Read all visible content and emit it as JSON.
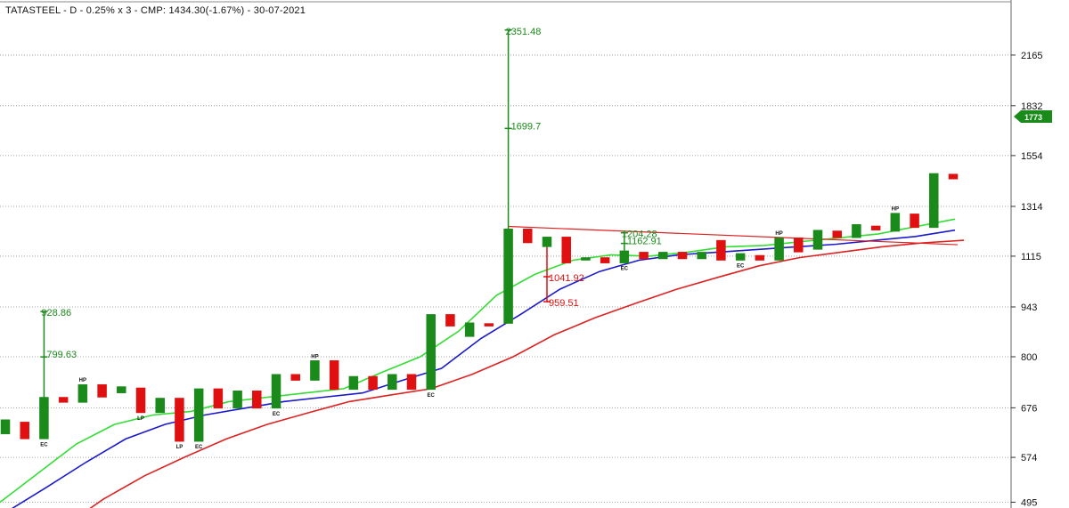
{
  "title": "TATASTEEL - D - 0.25% x 3 - CMP: 1434.30(-1.67%) - 30-07-2021",
  "colors": {
    "up": "#1a8a1a",
    "down": "#e01010",
    "ema_fast": "#33dd33",
    "ema_mid": "#1a1acc",
    "ema_slow": "#dd2222",
    "trendline": "#dd2222",
    "current_price_tag": "#1a8a1a"
  },
  "chart_data": {
    "type": "line",
    "title": "TATASTEEL - D - 0.25% x 3 - CMP: 1434.30(-1.67%) - 30-07-2021",
    "y_axis": {
      "scale": "log",
      "range": [
        480,
        2500
      ],
      "ticks": [
        574,
        676,
        800,
        943,
        1115,
        1314,
        1554,
        1832,
        2165,
        495
      ]
    },
    "grid": true,
    "current_price_tag": "1773",
    "bricks": [
      {
        "dir": "up",
        "low": 620,
        "high": 650
      },
      {
        "dir": "down",
        "low": 610,
        "high": 645
      },
      {
        "dir": "up",
        "low": 610,
        "high": 700,
        "label": "EC"
      },
      {
        "dir": "down",
        "low": 688,
        "high": 700
      },
      {
        "dir": "up",
        "low": 688,
        "high": 730,
        "label": "HP"
      },
      {
        "dir": "down",
        "low": 700,
        "high": 730
      },
      {
        "dir": "up",
        "low": 710,
        "high": 725
      },
      {
        "dir": "down",
        "low": 665,
        "high": 722,
        "label": "LP"
      },
      {
        "dir": "up",
        "low": 665,
        "high": 698
      },
      {
        "dir": "down",
        "low": 605,
        "high": 698,
        "label": "LP"
      },
      {
        "dir": "up",
        "low": 605,
        "high": 720,
        "label": "EC"
      },
      {
        "dir": "down",
        "low": 675,
        "high": 720
      },
      {
        "dir": "up",
        "low": 675,
        "high": 715
      },
      {
        "dir": "down",
        "low": 675,
        "high": 715
      },
      {
        "dir": "up",
        "low": 675,
        "high": 755,
        "label": "EC"
      },
      {
        "dir": "down",
        "low": 740,
        "high": 755
      },
      {
        "dir": "up",
        "low": 740,
        "high": 790,
        "label": "HP"
      },
      {
        "dir": "down",
        "low": 718,
        "high": 790
      },
      {
        "dir": "up",
        "low": 718,
        "high": 750
      },
      {
        "dir": "down",
        "low": 718,
        "high": 750
      },
      {
        "dir": "up",
        "low": 718,
        "high": 755
      },
      {
        "dir": "down",
        "low": 718,
        "high": 755
      },
      {
        "dir": "up",
        "low": 718,
        "high": 920,
        "label": "EC"
      },
      {
        "dir": "down",
        "low": 885,
        "high": 920
      },
      {
        "dir": "up",
        "low": 855,
        "high": 895
      },
      {
        "dir": "down",
        "low": 885,
        "high": 893
      },
      {
        "dir": "up",
        "low": 893,
        "high": 1220
      },
      {
        "dir": "down",
        "low": 1165,
        "high": 1220
      },
      {
        "dir": "up",
        "low": 1150,
        "high": 1188
      },
      {
        "dir": "down",
        "low": 1090,
        "high": 1188
      },
      {
        "dir": "up",
        "low": 1100,
        "high": 1110
      },
      {
        "dir": "down",
        "low": 1090,
        "high": 1110
      },
      {
        "dir": "up",
        "low": 1090,
        "high": 1135,
        "label": "EC"
      },
      {
        "dir": "down",
        "low": 1105,
        "high": 1130
      },
      {
        "dir": "up",
        "low": 1105,
        "high": 1130
      },
      {
        "dir": "down",
        "low": 1105,
        "high": 1130
      },
      {
        "dir": "up",
        "low": 1105,
        "high": 1130
      },
      {
        "dir": "down",
        "low": 1100,
        "high": 1175
      },
      {
        "dir": "up",
        "low": 1100,
        "high": 1125,
        "label": "EC"
      },
      {
        "dir": "down",
        "low": 1100,
        "high": 1118
      },
      {
        "dir": "up",
        "low": 1100,
        "high": 1185,
        "label": "HP"
      },
      {
        "dir": "down",
        "low": 1130,
        "high": 1185
      },
      {
        "dir": "up",
        "low": 1140,
        "high": 1215
      },
      {
        "dir": "down",
        "low": 1185,
        "high": 1212
      },
      {
        "dir": "up",
        "low": 1185,
        "high": 1238
      },
      {
        "dir": "down",
        "low": 1215,
        "high": 1232
      },
      {
        "dir": "up",
        "low": 1210,
        "high": 1285,
        "label": "HP"
      },
      {
        "dir": "down",
        "low": 1225,
        "high": 1282
      },
      {
        "dir": "up",
        "low": 1225,
        "high": 1465
      },
      {
        "dir": "down",
        "low": 1438,
        "high": 1462
      }
    ],
    "wicks": [
      {
        "brick": 2,
        "high": 928.86,
        "labels": [
          "928.86",
          "799.63"
        ],
        "mid": 799.63
      },
      {
        "brick": 26,
        "high": 2351.48,
        "labels": [
          "2351.48",
          "1699.7"
        ],
        "mid": 1699.7
      },
      {
        "brick": 28,
        "low": 959.51,
        "labels": [
          "1041.92",
          "959.51"
        ],
        "mid": 1041.92
      },
      {
        "brick": 32,
        "high": 1204.28,
        "labels": [
          "1204.28",
          "1162.91"
        ],
        "mid": 1162.91
      }
    ],
    "series": [
      {
        "values": [
          495,
          545,
          600,
          640,
          660,
          668,
          690,
          700,
          710,
          720,
          760,
          800,
          870,
          980,
          1050,
          1100,
          1120,
          1115,
          1130,
          1150,
          1155,
          1170,
          1185,
          1200,
          1230,
          1260
        ]
      },
      {
        "values": [
          480,
          520,
          565,
          610,
          640,
          660,
          675,
          690,
          700,
          710,
          740,
          770,
          850,
          920,
          1000,
          1060,
          1100,
          1120,
          1130,
          1140,
          1150,
          1160,
          1175,
          1190,
          1215
        ]
      },
      {
        "values": [
          455,
          500,
          540,
          575,
          610,
          640,
          665,
          690,
          705,
          720,
          755,
          800,
          860,
          910,
          955,
          1000,
          1040,
          1080,
          1110,
          1130,
          1150,
          1165,
          1175
        ]
      }
    ],
    "trendline": {
      "from": 1230,
      "to": 1158
    }
  }
}
